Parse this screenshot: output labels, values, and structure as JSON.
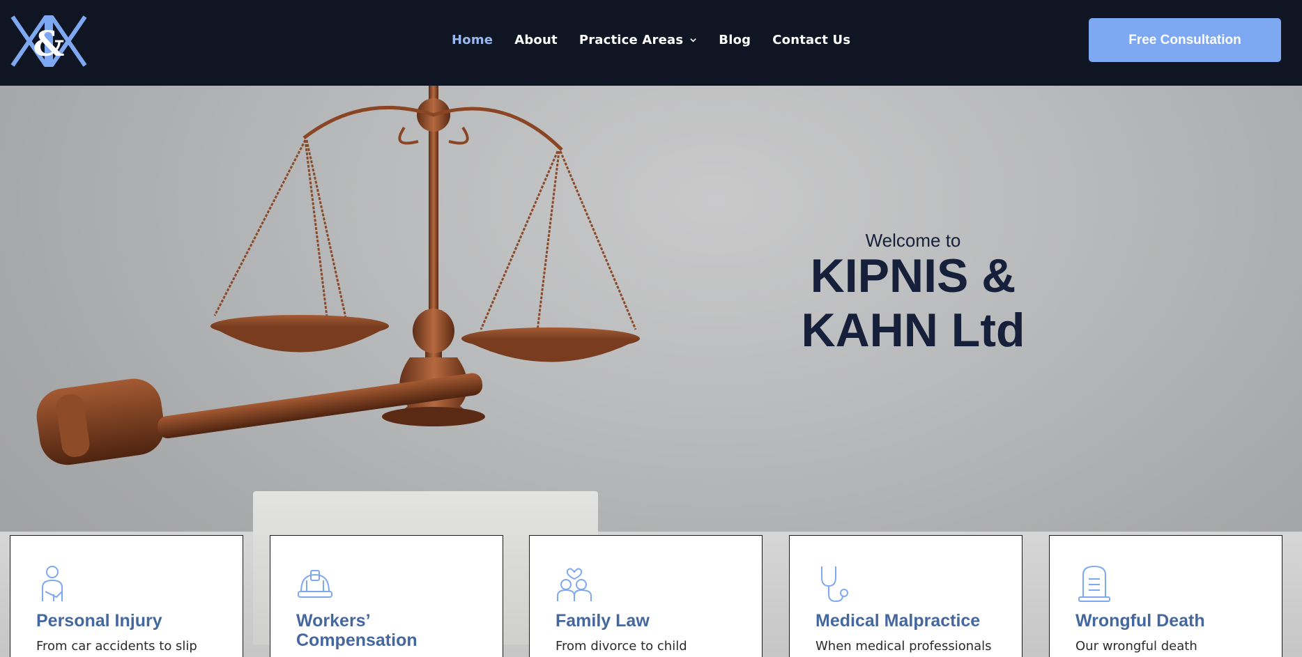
{
  "header": {
    "logo_text": "K&K",
    "nav": [
      {
        "label": "Home",
        "active": true
      },
      {
        "label": "About",
        "active": false
      },
      {
        "label": "Practice Areas",
        "active": false
      },
      {
        "label": "Blog",
        "active": false
      },
      {
        "label": "Contact Us",
        "active": false
      }
    ],
    "cta_label": "Free Consultation"
  },
  "hero": {
    "welcome": "Welcome to",
    "title_line1": "KIPNIS &",
    "title_line2": "KAHN Ltd"
  },
  "cards": [
    {
      "icon": "injured-person-icon",
      "title": "Personal Injury",
      "desc": "From car accidents to slip"
    },
    {
      "icon": "hard-hat-icon",
      "title": "Workers’ Compensation",
      "desc": ""
    },
    {
      "icon": "family-heart-icon",
      "title": "Family Law",
      "desc": "From divorce to child"
    },
    {
      "icon": "stethoscope-icon",
      "title": "Medical Malpractice",
      "desc": "When medical professionals"
    },
    {
      "icon": "tombstone-icon",
      "title": "Wrongful Death",
      "desc": "Our wrongful death"
    }
  ],
  "colors": {
    "header_bg": "#0f1522",
    "accent": "#7fa8f2",
    "nav_active": "#9ab8f0",
    "card_title": "#44679e",
    "hero_title": "#16203a"
  }
}
